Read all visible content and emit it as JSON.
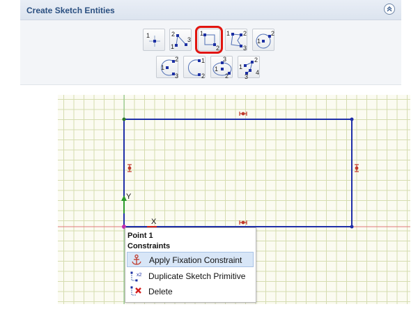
{
  "panel": {
    "title": "Create Sketch Entities"
  },
  "tools": [
    {
      "name": "point",
      "labels": [
        "1"
      ]
    },
    {
      "name": "polyline",
      "labels": [
        "2",
        "1",
        "3"
      ]
    },
    {
      "name": "rectangle",
      "labels": [
        "1",
        "2"
      ]
    },
    {
      "name": "polygon",
      "labels": [
        "1",
        "2",
        "3"
      ]
    },
    {
      "name": "circle",
      "labels": [
        "1",
        "2"
      ]
    },
    {
      "name": "arc-center",
      "labels": [
        "1",
        "2",
        "3"
      ]
    },
    {
      "name": "arc-three-point",
      "labels": [
        "1",
        "2"
      ]
    },
    {
      "name": "ellipse",
      "labels": [
        "3",
        "1",
        "2"
      ]
    },
    {
      "name": "spline",
      "labels": [
        "1",
        "2",
        "3",
        "4"
      ]
    }
  ],
  "sketch": {
    "y_axis_label": "Y",
    "x_axis_label": "X"
  },
  "context_menu": {
    "title": "Point 1",
    "section": "Constraints",
    "items": [
      {
        "label": "Apply Fixation Constraint",
        "icon": "anchor-icon"
      },
      {
        "label": "Duplicate Sketch Primitive",
        "icon": "duplicate-icon"
      },
      {
        "label": "Delete",
        "icon": "delete-icon"
      }
    ]
  },
  "colors": {
    "highlight": "#e1140f",
    "sketch_line": "#1f2fa8",
    "constraint": "#c0392b",
    "menu_active": "#d8e6f7"
  }
}
